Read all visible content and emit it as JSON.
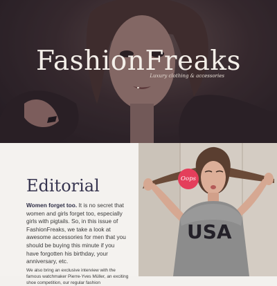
{
  "hero": {
    "brand": "FashionFreaks",
    "tagline": "Luxury clothing & accessories"
  },
  "editorial": {
    "heading": "Editorial",
    "lead_bold": "Women forget too.",
    "lead_rest": " It is no secret that women and girls forget too, especially girls with pigtails. So, in this issue of FashionFreaks, we take a look at awesome accessories for men that you should be buying this minute if you have forgotten his birthday, your anniversary, etc.",
    "body2": "We also bring an exclusive interview with the famous watchmaker Pierre-Yves Müller, an exciting shoe competition, our regular fashion"
  },
  "photo2": {
    "badge": "Oops",
    "shirt_text": "USA"
  },
  "colors": {
    "badge": "#e43e5b",
    "heading": "#36344f"
  }
}
